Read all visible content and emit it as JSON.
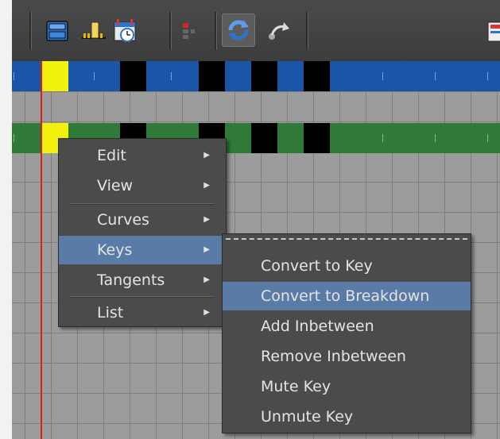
{
  "context_menu": {
    "items": [
      {
        "label": "Edit",
        "has_submenu": true
      },
      {
        "label": "View",
        "has_submenu": true
      },
      {
        "label": "Curves",
        "has_submenu": true
      },
      {
        "label": "Keys",
        "has_submenu": true
      },
      {
        "label": "Tangents",
        "has_submenu": true
      },
      {
        "label": "List",
        "has_submenu": true
      }
    ],
    "active_item": "Keys",
    "submenu_arrow": "▶"
  },
  "keys_submenu": {
    "items": [
      {
        "label": "Convert to Key"
      },
      {
        "label": "Convert to Breakdown"
      },
      {
        "label": "Add Inbetween"
      },
      {
        "label": "Remove Inbetween"
      },
      {
        "label": "Mute Key"
      },
      {
        "label": "Unmute Key"
      }
    ],
    "highlighted_item": "Convert to Breakdown"
  },
  "toolbar": {
    "icons": [
      "layout-icon",
      "scale-keys-icon",
      "timeline-clock-icon",
      "red-key-icon",
      "auto-sync-icon",
      "redo-curve-icon",
      "graph-editor-icon"
    ],
    "active_icon": "auto-sync-icon"
  },
  "colors": {
    "menu_bg": "#4b4b4b",
    "highlight": "#5a7ba5",
    "blue_track": "#1a56a8",
    "green_track": "#2f7a39",
    "key_yellow": "#f1f10d",
    "playhead": "#d42020"
  }
}
